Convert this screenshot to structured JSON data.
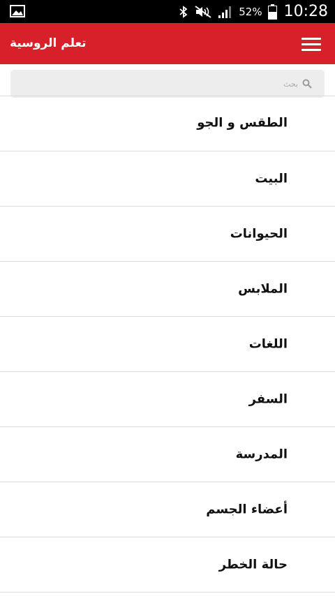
{
  "status_bar": {
    "battery": "52%",
    "time": "10:28"
  },
  "app_bar": {
    "title": "تعلم الروسية"
  },
  "search": {
    "placeholder": "بحث"
  },
  "categories": [
    {
      "label": "الطقس و الجو"
    },
    {
      "label": "البيت"
    },
    {
      "label": "الحيوانات"
    },
    {
      "label": "الملابس"
    },
    {
      "label": "اللغات"
    },
    {
      "label": "السفر"
    },
    {
      "label": "المدرسة"
    },
    {
      "label": "أعضاء الجسم"
    },
    {
      "label": "حالة الخطر"
    }
  ],
  "colors": {
    "app_bar": "#d8202b",
    "status_bar": "#000000",
    "search_bg": "#ededed"
  }
}
